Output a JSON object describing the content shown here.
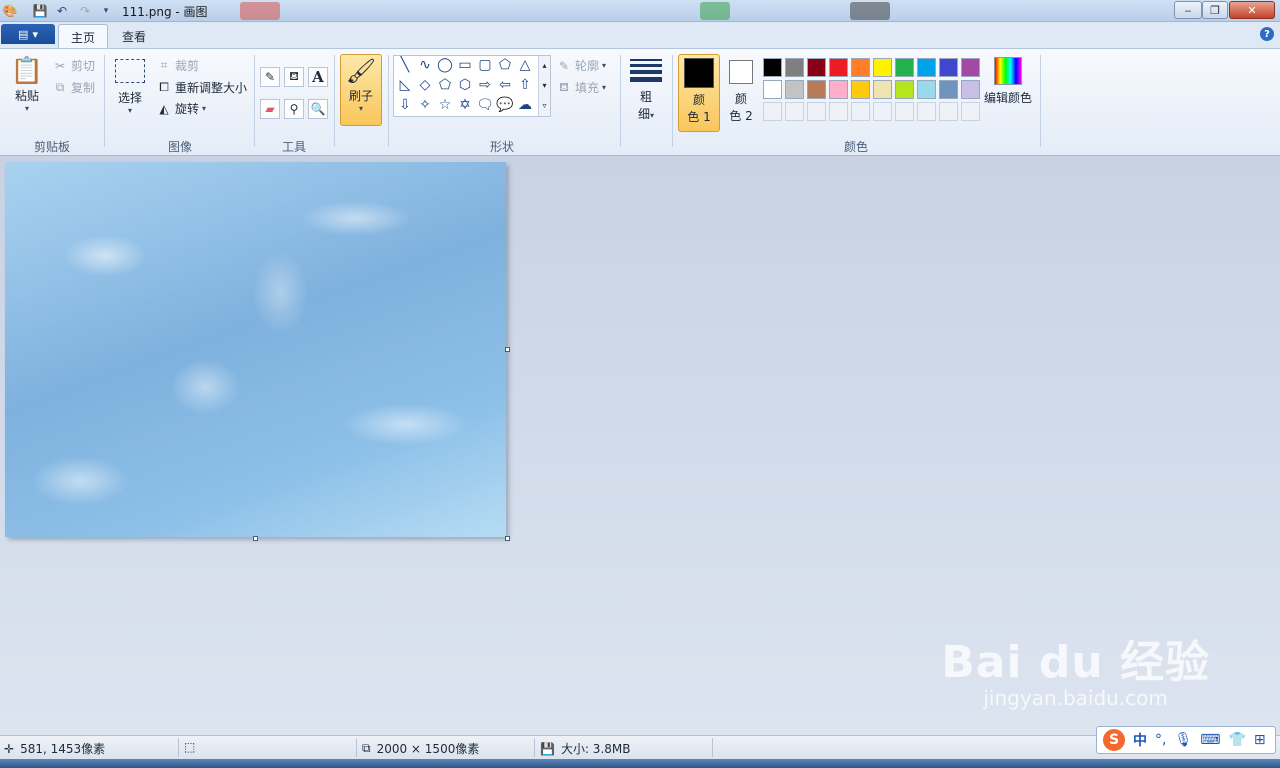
{
  "window": {
    "title": "111.png - 画图",
    "buttons": {
      "minimize": "‒",
      "maximize": "❐",
      "close": "✕"
    }
  },
  "ribbon_tabs": [
    "主页",
    "查看"
  ],
  "clipboard": {
    "paste": "粘贴",
    "cut": "剪切",
    "copy": "复制",
    "label": "剪贴板"
  },
  "image": {
    "select": "选择",
    "crop": "裁剪",
    "resize": "重新调整大小",
    "rotate": "旋转",
    "label": "图像"
  },
  "tools": {
    "label": "工具"
  },
  "brushes": {
    "label": "刷子"
  },
  "shapes": {
    "outline": "轮廓",
    "fill": "填充",
    "label": "形状"
  },
  "size": {
    "label_top": "粗",
    "label_bottom": "细"
  },
  "colors": {
    "color1_top": "颜",
    "color1_bottom": "色 1",
    "color2_top": "颜",
    "color2_bottom": "色 2",
    "edit": "编辑颜色",
    "label": "颜色",
    "color1_value": "#000000",
    "color2_value": "#ffffff",
    "palette_row1": [
      "#000000",
      "#7f7f7f",
      "#880015",
      "#ed1c24",
      "#ff7f27",
      "#fff200",
      "#22b14c",
      "#00a2e8",
      "#3f48cc",
      "#a349a4"
    ],
    "palette_row2": [
      "#ffffff",
      "#c3c3c3",
      "#b97a57",
      "#ffaec9",
      "#ffc90e",
      "#efe4b0",
      "#b5e61d",
      "#99d9ea",
      "#7092be",
      "#c8bfe7"
    ]
  },
  "status": {
    "cursor": "581, 1453像素",
    "image_size": "2000 × 1500像素",
    "file_size": "大小: 3.8MB"
  },
  "watermark": {
    "main": "Bai du 经验",
    "sub": "jingyan.baidu.com"
  },
  "ime": {
    "logo": "S",
    "mode": "中",
    "punct": "°,"
  }
}
